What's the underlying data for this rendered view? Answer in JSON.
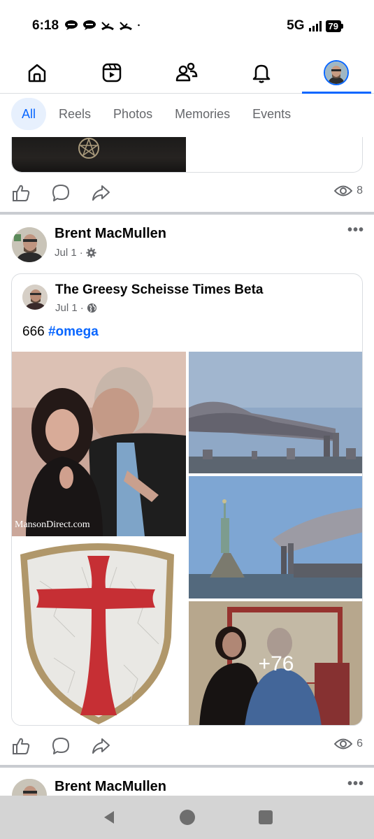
{
  "status_bar": {
    "time": "6:18",
    "network": "5G",
    "battery": "79"
  },
  "nav": {
    "items": [
      "home-icon",
      "video-icon",
      "friends-icon",
      "notifications-icon",
      "profile-avatar"
    ],
    "active": "profile-avatar",
    "accent": "#0866ff"
  },
  "filters": {
    "chips": [
      "All",
      "Reels",
      "Photos",
      "Memories",
      "Events"
    ],
    "active": "All"
  },
  "prev_post": {
    "views": "8"
  },
  "post": {
    "author": "Brent MacMullen",
    "date": "Jul 1",
    "audience_icon": "gear-icon",
    "views": "6",
    "shared": {
      "page_name": "The Greesy Scheisse Times Beta",
      "date": "Jul 1",
      "audience_icon": "globe-icon",
      "text_plain": "666 ",
      "hashtag": "#omega",
      "photo_caption": "MansonDirect.com",
      "more_photos": "+76"
    }
  },
  "next_post": {
    "author": "Brent MacMullen"
  }
}
